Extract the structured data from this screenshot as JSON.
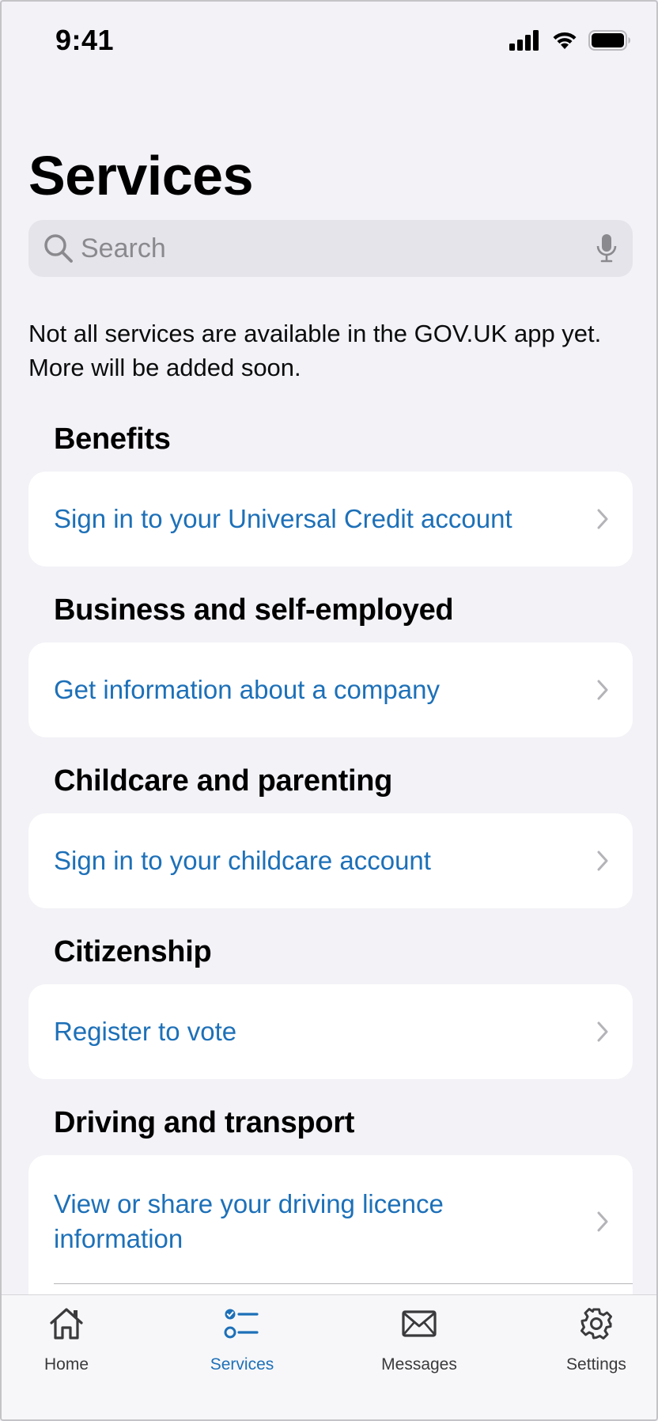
{
  "status_bar": {
    "time": "9:41"
  },
  "page": {
    "title": "Services"
  },
  "search": {
    "placeholder": "Search"
  },
  "notice": "Not all services are available in the GOV.UK app yet. More will be added soon.",
  "sections": [
    {
      "heading": "Benefits",
      "link": "Sign in to your Universal Credit account"
    },
    {
      "heading": "Business and self-employed",
      "link": "Get information about a company"
    },
    {
      "heading": "Childcare and parenting",
      "link": "Sign in to your childcare account"
    },
    {
      "heading": "Citizenship",
      "link": "Register to vote"
    },
    {
      "heading": "Driving and transport",
      "link": "View or share your driving licence information"
    }
  ],
  "tabs": [
    {
      "label": "Home",
      "icon": "home-icon",
      "active": false
    },
    {
      "label": "Services",
      "icon": "services-icon",
      "active": true
    },
    {
      "label": "Messages",
      "icon": "envelope-icon",
      "active": false
    },
    {
      "label": "Settings",
      "icon": "gear-icon",
      "active": false
    }
  ],
  "colors": {
    "link": "#1d70b8",
    "background": "#f2f2f7",
    "card": "#ffffff"
  }
}
